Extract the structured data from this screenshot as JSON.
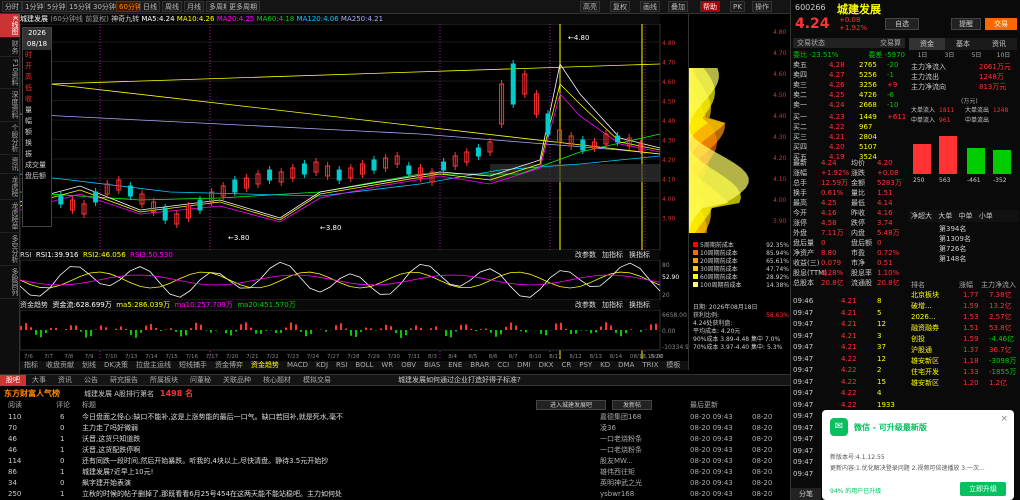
{
  "toolbar": {
    "tabs": [
      "分时",
      "1分钟",
      "5分钟",
      "15分钟",
      "30分钟",
      "60分钟",
      "日线",
      "周线",
      "月线",
      "多周期",
      "更多周期"
    ],
    "active_tab": "60分钟",
    "right_tabs": [
      "高亮",
      "复权",
      "画线",
      "叠加",
      "帮助",
      "PK",
      "操作"
    ]
  },
  "left_side": [
    "K线图",
    "财务",
    "F10资料",
    "深度资料",
    "个股分析",
    "资讯",
    "龙虎榜",
    "龙虎榜单",
    "多空分析",
    "多股同列"
  ],
  "ohlc_box": {
    "date_label": "2026\n08/18",
    "fields": [
      "时",
      "开",
      "高",
      "低",
      "收",
      "量",
      "幅",
      "额",
      "换",
      "振",
      "成交量",
      "盘后额"
    ]
  },
  "main_header": {
    "name": "城建发展",
    "period": "(60分钟线 前复权)",
    "ma_labels": [
      "神奇九转",
      "MA5:4.24",
      "MA10:4.26",
      "MA20:4.25",
      "MA60:4.18",
      "MA120:4.06",
      "MA250:4.21"
    ]
  },
  "price_axis": [
    "4.80",
    "4.70",
    "4.60",
    "4.50",
    "4.40",
    "4.30",
    "4.20",
    "4.10",
    "4.00",
    "3.90"
  ],
  "date_axis": [
    "7/6",
    "7/7",
    "7/8",
    "7/9",
    "7/10",
    "7/13",
    "7/14",
    "7/15",
    "7/16",
    "7/17",
    "7/20",
    "7/21",
    "7/22",
    "7/23",
    "7/24",
    "7/27",
    "7/28",
    "7/29",
    "7/30",
    "7/31",
    "8/3",
    "8/4",
    "8/5",
    "8/6",
    "8/7",
    "8/10",
    "8/11",
    "8/12",
    "8/13",
    "8/14",
    "08/18,15:00",
    "8/20"
  ],
  "annotations": {
    "high": "4.80",
    "low1": "3.80",
    "low2": "3.80"
  },
  "rsi_header": {
    "name": "RSI",
    "rsi1": "RSI1:39.916",
    "rsi2": "RSI2:46.056",
    "rsi3": "RSI3:50.530",
    "right_btns": [
      "改参数",
      "加指标",
      "换指标"
    ]
  },
  "rsi_axis": [
    "80",
    "52.90",
    "20"
  ],
  "fund_header": {
    "name": "资金趋势",
    "l1": "资金流:628.699万",
    "l2": "ma5:286.039万",
    "l3": "ma10:257.709万",
    "l4": "ma20:451.570万"
  },
  "fund_axis": [
    "6658.00",
    "0.00",
    "-10334.96"
  ],
  "vol_tabs": [
    "指标",
    "收盘贡献",
    "划线",
    "DK决策",
    "拉盘主运线",
    "短线捕手",
    "资金博弈",
    "资金趋势",
    "MACD",
    "KDJ",
    "RSI",
    "BOLL",
    "WR",
    "OBV",
    "BIAS",
    "ENE",
    "BRAR",
    "CCI",
    "DMI",
    "DKX",
    "CR",
    "PSY",
    "KD",
    "DMA",
    "TRIX",
    "模板"
  ],
  "active_vol_tab": "资金趋势",
  "chip": {
    "legend": [
      {
        "label": "5周期前成本",
        "val": "92.35%",
        "color": "#f00"
      },
      {
        "label": "10周期前成本",
        "val": "85.94%",
        "color": "#f60"
      },
      {
        "label": "20周期前成本",
        "val": "65.61%",
        "color": "#f90"
      },
      {
        "label": "30周期前成本",
        "val": "47.74%",
        "color": "#fc0"
      },
      {
        "label": "60周期前成本",
        "val": "28.92%",
        "color": "#ff0"
      },
      {
        "label": "100周期前成本",
        "val": "14.38%",
        "color": "#ff6"
      }
    ],
    "date": "日期: 2026年08月18日",
    "profit": "获利比例:",
    "profit_val": "58.63%",
    "profit_chip": "4.24处获利盘:",
    "profit_chip_val": "",
    "avg_cost": "平均成本: 4.20元",
    "r90": "90%成本 3.89-4.48 集中 7.0%",
    "r70": "70%成本 3.97-4.40 集中: 5.3%"
  },
  "quote": {
    "code": "600266",
    "name": "城建发展",
    "price": "4.24",
    "chg": "+0.08",
    "pct": "+1.92%",
    "btns": [
      "自选",
      "提醒",
      "交易"
    ],
    "tabs1": [
      "交易状态",
      "交易算"
    ],
    "wb": "委比 -23.51%",
    "wc": "委差 -5970",
    "asks": [
      [
        "卖五",
        "4.28",
        "2765",
        "-20"
      ],
      [
        "卖四",
        "4.27",
        "5256",
        "-1"
      ],
      [
        "卖三",
        "4.26",
        "3256",
        "+9"
      ],
      [
        "卖二",
        "4.25",
        "4726",
        "-6"
      ],
      [
        "卖一",
        "4.24",
        "2668",
        "-10"
      ]
    ],
    "bids": [
      [
        "买一",
        "4.23",
        "1449",
        "+611"
      ],
      [
        "买二",
        "4.22",
        "967",
        ""
      ],
      [
        "买三",
        "4.21",
        "2804",
        ""
      ],
      [
        "买四",
        "4.20",
        "5107",
        ""
      ],
      [
        "买五",
        "4.19",
        "3524",
        ""
      ]
    ],
    "stats": [
      [
        "最新",
        "4.24",
        "均价",
        "4.20"
      ],
      [
        "涨幅",
        "+1.92%",
        "涨跌",
        "+0.08"
      ],
      [
        "总手",
        "12.59万",
        "金额",
        "5283万"
      ],
      [
        "换手",
        "0.61%",
        "量比",
        "1.51"
      ],
      [
        "最高",
        "4.25",
        "最低",
        "4.14"
      ],
      [
        "今开",
        "4.16",
        "昨收",
        "4.16"
      ],
      [
        "涨停",
        "4.58",
        "跌停",
        "3.74"
      ],
      [
        "外盘",
        "7.11万",
        "内盘",
        "5.48万"
      ],
      [
        "盘后量",
        "0",
        "盘后额",
        "0"
      ],
      [
        "净资产",
        "8.80",
        "市盈",
        "0.72%"
      ],
      [
        "收益(三)",
        "0.079",
        "市净",
        "0.51"
      ],
      [
        "股息(TTM)",
        "3.28%",
        "股息率",
        "1.10%"
      ],
      [
        "总股本",
        "20.8亿",
        "流通股",
        "20.8亿"
      ]
    ],
    "flow_tabs": [
      "资金",
      "基本",
      "资讯"
    ],
    "flow_period": [
      "1日",
      "3日",
      "5日",
      "10日"
    ],
    "flow": [
      [
        "主力净流入",
        "2061万元"
      ],
      [
        "主力流出",
        "1248万"
      ],
      [
        "主力净流向",
        "813万元"
      ]
    ],
    "flow_unit": "(万元)",
    "flow_bars": {
      "big_in": "1811",
      "big_out": "1248",
      "mid_in": "",
      "mid_out": "",
      "v1": "250",
      "v2": "563",
      "v3": "-461",
      "v4": "-352",
      "v5": "949"
    },
    "flow_rows": [
      [
        "大单流入",
        "1811",
        "大单流出",
        "1248"
      ],
      [
        "中单流入",
        "961",
        "中单流出",
        ""
      ]
    ],
    "board_title": "净超大",
    "board_tabs": [
      "大单",
      "中单",
      "小单"
    ],
    "ticks": [
      [
        "09:46",
        "4.21",
        "8",
        "↑"
      ],
      [
        "09:47",
        "4.21",
        "5",
        ""
      ],
      [
        "09:47",
        "4.21",
        "12",
        ""
      ],
      [
        "09:47",
        "4.21",
        "3",
        ""
      ],
      [
        "09:47",
        "4.21",
        "37",
        ""
      ],
      [
        "09:47",
        "4.22",
        "12",
        ""
      ],
      [
        "09:47",
        "4.22",
        "2",
        ""
      ],
      [
        "09:47",
        "4.22",
        "15",
        ""
      ],
      [
        "09:47",
        "4.22",
        "4",
        ""
      ],
      [
        "09:47",
        "4.22",
        "1933",
        ""
      ],
      [
        "09:47",
        "4.22",
        "29",
        ""
      ],
      [
        "09:47",
        "4.22",
        "46",
        ""
      ],
      [
        "09:47",
        "4.21",
        "10",
        ""
      ],
      [
        "09:47",
        "4.21",
        "135",
        ""
      ],
      [
        "09:47",
        "4.21",
        "20",
        ""
      ],
      [
        "09:47",
        "4.21",
        "4",
        ""
      ]
    ],
    "sectors_head": [
      "排名",
      "涨幅",
      "主力净流入"
    ],
    "sectors": [
      [
        "北京板块",
        "1.77",
        "7.38亿"
      ],
      [
        "破增...",
        "1.59",
        "13.2亿"
      ],
      [
        "2026...",
        "1.53",
        "2.57亿"
      ],
      [
        "融资融券",
        "1.51",
        "53.8亿"
      ],
      [
        "创投",
        "1.59",
        "-4.46亿"
      ],
      [
        "沪股通",
        "1.37",
        "36.7亿"
      ],
      [
        "雄安新区",
        "1.18",
        "-3098万"
      ],
      [
        "住宅开发",
        "1.33",
        "-1855万"
      ],
      [
        "雄安新区",
        "1.20",
        "1.2亿"
      ]
    ],
    "stock_rank": [
      [
        "第394名"
      ],
      [
        "第1309名"
      ],
      [
        "第726名"
      ],
      [
        "第148名"
      ]
    ],
    "bottom_tab": "分笔"
  },
  "news_tabs": [
    "股吧",
    "大事",
    "资讯",
    "公告",
    "研究报告",
    "所属板块",
    "问董秘",
    "关联品种",
    "核心题材",
    "模拟交易"
  ],
  "news_ticker": "城建发展如何通过企业打造好得子标准?",
  "forum": {
    "title": "东方财富人气榜",
    "sub": "城建发展  A股排行第名",
    "rank": "1498 名",
    "btns": [
      "进入城建发展吧",
      "发新帖"
    ],
    "header": [
      "阅读",
      "评论",
      "标题",
      "",
      "作者",
      "最后更新"
    ],
    "rows": [
      [
        "110",
        "6",
        "今日盘面之怪心:缺口不能补,这是上涨势能的最后一口气。缺口若回补,就是死水,毫不",
        "嘉德集团168",
        "08-20 09:43",
        "08-20"
      ],
      [
        "70",
        "0",
        "主力走了吗好微弱",
        "凌36",
        "08-20 09:43",
        "08-20"
      ],
      [
        "46",
        "1",
        "沃晋,这货只知道跌",
        "一口老烧粉条",
        "08-20 09:43",
        "08-20"
      ],
      [
        "46",
        "1",
        "沃晋,这货配跌停啊",
        "一口老烧粉条",
        "08-20 09:43",
        "08-20"
      ],
      [
        "114",
        "0",
        "还有同跌一段时间,然后开始暴跌。听我的,4块以上,尽快清盘。静待3.5元开始抄",
        "股友MW...",
        "08-20 09:43",
        "08-20"
      ],
      [
        "86",
        "1",
        "城建发展?近早上10元!",
        "雄伟西往矩",
        "08-20 09:43",
        "08-20"
      ],
      [
        "34",
        "0",
        "飙字建开始表演",
        "英明神武之光",
        "08-20 09:43",
        "08-20"
      ],
      [
        "250",
        "1",
        "立秋的时候的帖子删掉了,那既看看6月25号454在这两天能不能站稳吧。主力如何处",
        "ysbwr168",
        "08-20 09:43",
        "08-20"
      ]
    ]
  },
  "popup": {
    "app": "微信",
    "msg": "微信 - 可升级最新版",
    "ver": "新版本号:4.1.12.55",
    "desc": "更新内容:1.优化解决登录问题 2.视频可倍速播放 3.一次...",
    "pct": "94% 的用户已升级",
    "btn": "立即升级"
  },
  "bottom_status": "分笔"
}
